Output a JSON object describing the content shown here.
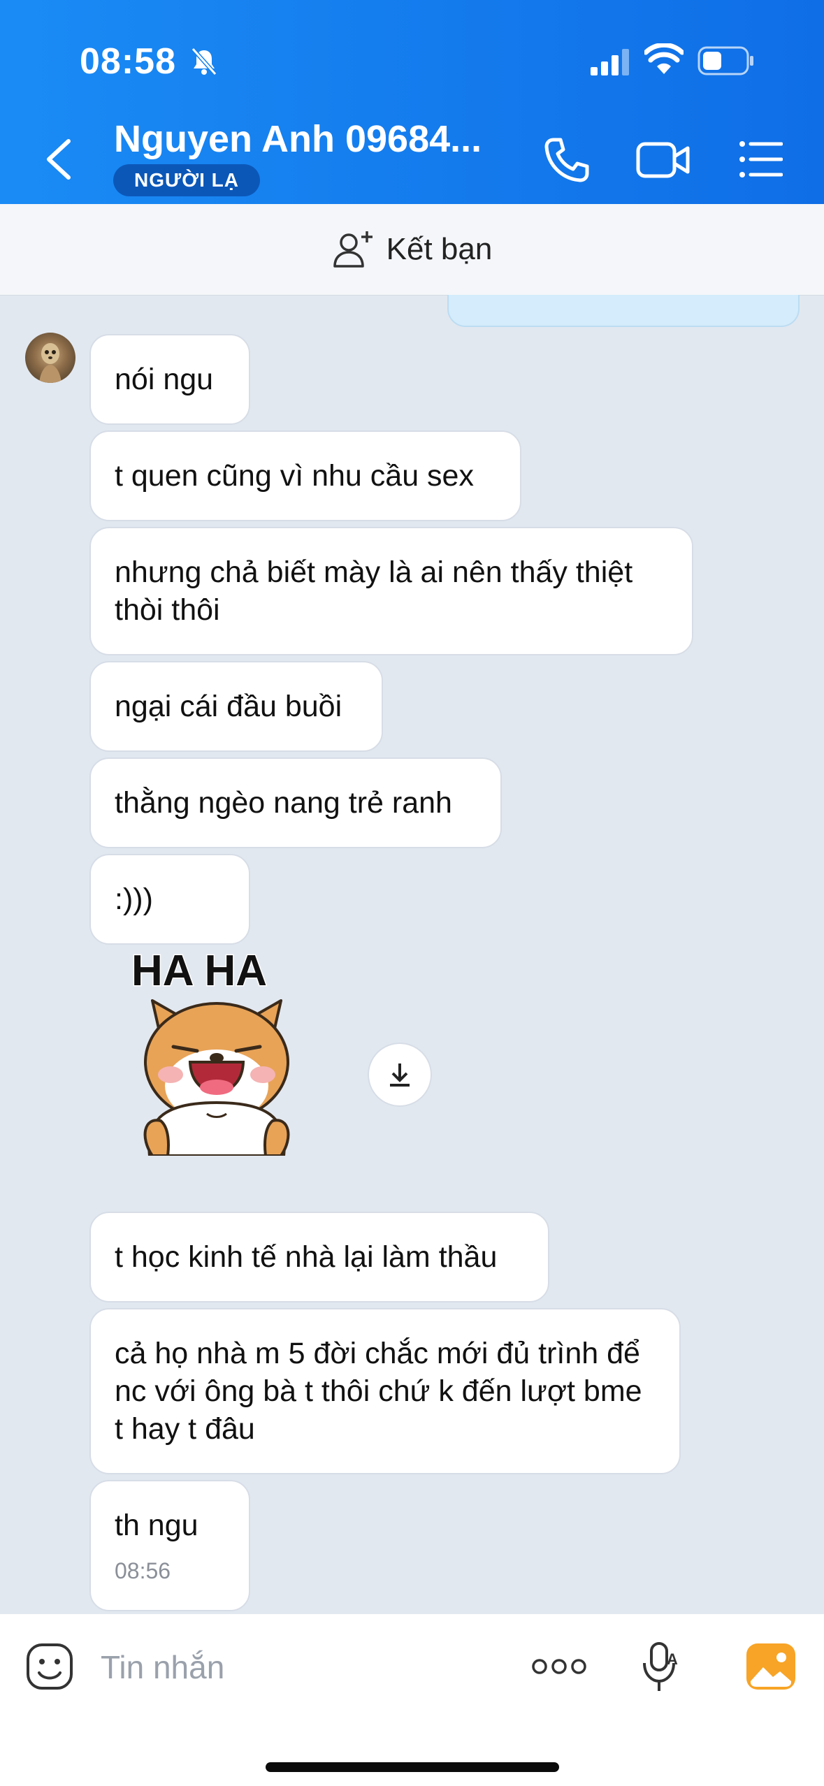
{
  "status_bar": {
    "time": "08:58"
  },
  "header": {
    "contact_name": "Nguyen Anh 09684...",
    "badge": "NGƯỜI LẠ",
    "icons": [
      "back-icon",
      "phone-icon",
      "video-icon",
      "menu-list-icon"
    ]
  },
  "add_friend": {
    "label": "Kết bạn"
  },
  "messages": [
    {
      "text": "nói ngu"
    },
    {
      "text": "t quen cũng vì nhu cầu sex"
    },
    {
      "text": "nhưng chả biết mày là ai nên thấy thiệt thòi thôi"
    },
    {
      "text": "ngại cái đầu buồi"
    },
    {
      "text": "thằng ngèo nang trẻ ranh"
    },
    {
      "text": ":)))"
    },
    {
      "text": "t học kinh tế nhà lại làm thầu"
    },
    {
      "text": "cả họ nhà m 5 đời chắc mới đủ trình để nc với ông bà t thôi chứ k đến lượt bme t hay t đâu"
    },
    {
      "text": "th ngu",
      "time": "08:56"
    }
  ],
  "sticker": {
    "caption": "HA HA"
  },
  "input": {
    "placeholder": "Tin nhắn"
  },
  "colors": {
    "header": "#1a8bf5",
    "badge": "#0b57b8",
    "chat_bg": "#e2e8f0",
    "accent": "#f7a427"
  }
}
